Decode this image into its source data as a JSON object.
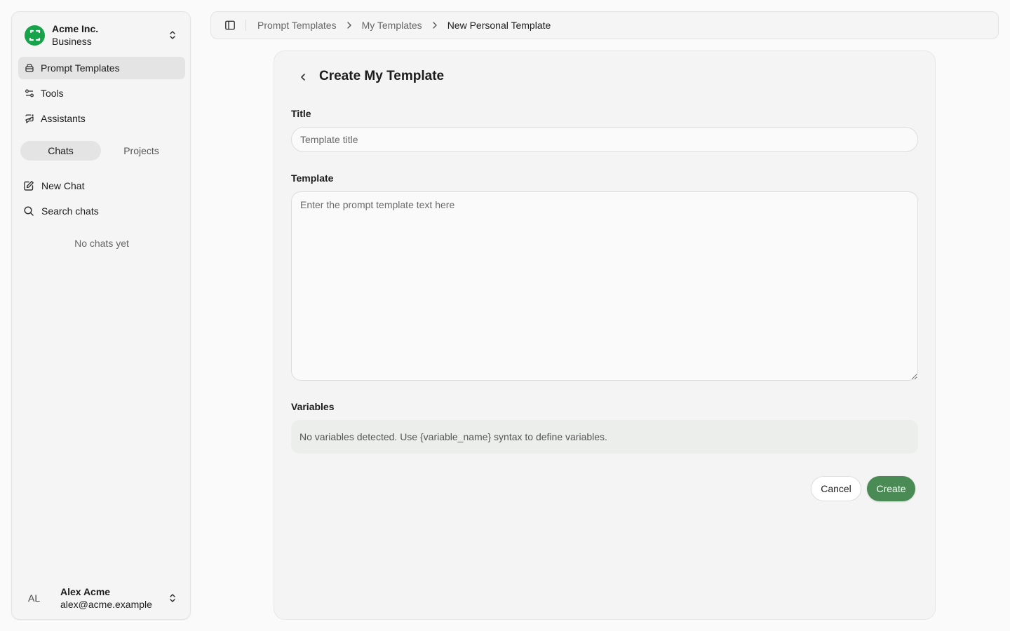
{
  "sidebar": {
    "org": {
      "name": "Acme Inc.",
      "plan": "Business",
      "logo_color": "#16a34a"
    },
    "nav": [
      {
        "label": "Prompt Templates",
        "icon": "template-icon",
        "active": true
      },
      {
        "label": "Tools",
        "icon": "tools-icon",
        "active": false
      },
      {
        "label": "Assistants",
        "icon": "assistant-icon",
        "active": false
      }
    ],
    "tabs": [
      {
        "label": "Chats",
        "active": true
      },
      {
        "label": "Projects",
        "active": false
      }
    ],
    "actions": [
      {
        "label": "New Chat",
        "icon": "edit-icon"
      },
      {
        "label": "Search chats",
        "icon": "search-icon"
      }
    ],
    "empty_text": "No chats yet",
    "user": {
      "initials": "AL",
      "name": "Alex Acme",
      "email": "alex@acme.example"
    }
  },
  "breadcrumb": [
    "Prompt Templates",
    "My Templates",
    "New Personal Template"
  ],
  "form": {
    "title": "Create My Template",
    "title_label": "Title",
    "title_placeholder": "Template title",
    "title_value": "",
    "template_label": "Template",
    "template_placeholder": "Enter the prompt template text here",
    "template_value": "",
    "variables_label": "Variables",
    "variables_empty": "No variables detected. Use {variable_name} syntax to define variables.",
    "cancel_label": "Cancel",
    "create_label": "Create"
  },
  "colors": {
    "accent": "#4a8a55",
    "active_bg": "#e3e4e3"
  }
}
